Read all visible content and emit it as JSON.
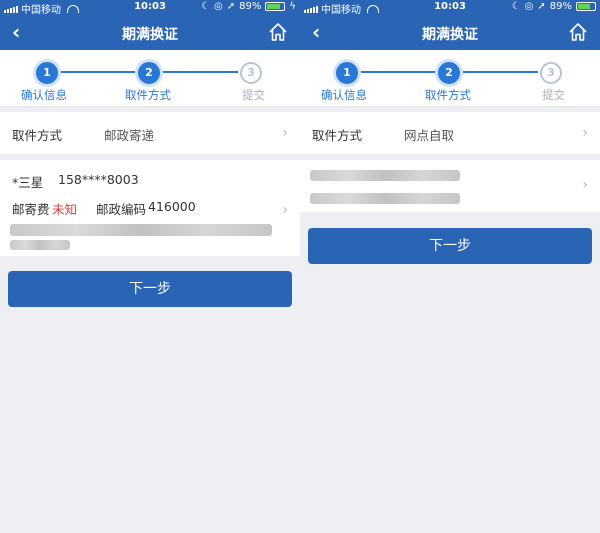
{
  "status": {
    "carrier": "中国移动",
    "time": "10:03",
    "battery": "89%",
    "battery_level": 0.89
  },
  "nav": {
    "title": "期满换证"
  },
  "steps": [
    {
      "num": "1",
      "label": "确认信息"
    },
    {
      "num": "2",
      "label": "取件方式"
    },
    {
      "num": "3",
      "label": "提交"
    }
  ],
  "left": {
    "pickup_label": "取件方式",
    "pickup_value": "邮政寄递",
    "recipient_name": "*三星",
    "recipient_phone": "158****8003",
    "postage_label": "邮寄费",
    "postage_value": "未知",
    "postcode_label": "邮政编码",
    "postcode_value": "416000",
    "next_button": "下一步"
  },
  "right": {
    "pickup_label": "取件方式",
    "pickup_value": "网点自取",
    "next_button": "下一步"
  },
  "colors": {
    "primary": "#2a64b4",
    "step_active": "#2a78d6",
    "warning": "#e23a3a"
  }
}
